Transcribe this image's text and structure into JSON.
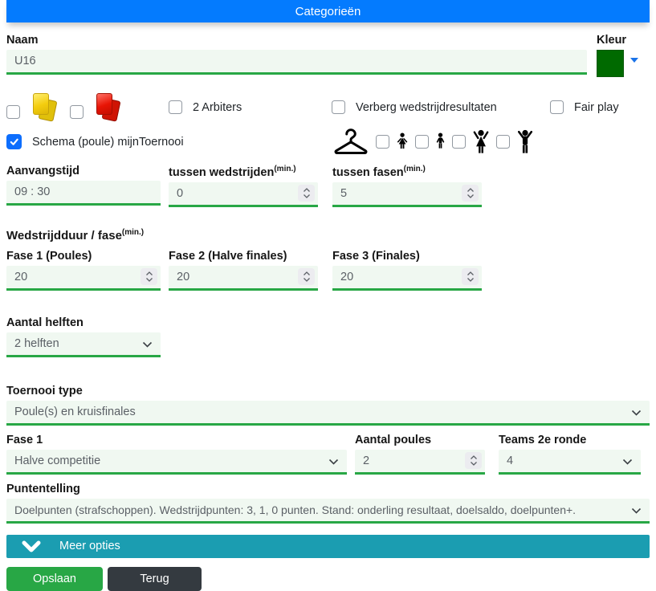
{
  "header": {
    "title": "Categorieën"
  },
  "name_field": {
    "label": "Naam",
    "value": "U16"
  },
  "color_field": {
    "label": "Kleur",
    "value": "#006a00"
  },
  "option_row": {
    "yellow_card": {
      "checked": false,
      "icon": "yellow-cards-icon"
    },
    "red_card": {
      "checked": false,
      "icon": "red-cards-icon"
    },
    "two_arbiters": {
      "label": "2 Arbiters",
      "checked": false
    },
    "hide_results": {
      "label": "Verberg wedstrijdresultaten",
      "checked": false
    },
    "fair_play": {
      "label": "Fair play",
      "checked": false
    }
  },
  "schema_checkbox": {
    "label": "Schema (poule) mijnToernooi",
    "checked": true
  },
  "dress_row": {
    "icons": [
      "hanger-icon",
      "girl-icon",
      "boy-icon",
      "woman-icon",
      "man-icon"
    ],
    "girl": {
      "checked": false
    },
    "boy": {
      "checked": false
    },
    "woman": {
      "checked": false
    },
    "man": {
      "checked": false
    }
  },
  "timing": {
    "start_time": {
      "label": "Aanvangstijd",
      "value": "09 : 30"
    },
    "between_matches": {
      "label": "tussen wedstrijden",
      "unit": "(min.)",
      "value": "0"
    },
    "between_phases": {
      "label": "tussen fasen",
      "unit": "(min.)",
      "value": "5"
    }
  },
  "match_duration": {
    "heading": "Wedstrijdduur / fase",
    "unit": "(min.)",
    "fase1": {
      "label": "Fase 1 (Poules)",
      "value": "20"
    },
    "fase2": {
      "label": "Fase 2 (Halve finales)",
      "value": "20"
    },
    "fase3": {
      "label": "Fase 3 (Finales)",
      "value": "20"
    }
  },
  "halves": {
    "label": "Aantal helften",
    "value": "2 helften"
  },
  "tournament_type": {
    "label": "Toernooi type",
    "value": "Poule(s) en kruisfinales"
  },
  "phase1": {
    "label": "Fase 1",
    "value": "Halve competitie"
  },
  "pool_count": {
    "label": "Aantal poules",
    "value": "2"
  },
  "teams_round2": {
    "label": "Teams 2e ronde",
    "value": "4"
  },
  "scoring": {
    "label": "Puntentelling",
    "value": "Doelpunten (strafschoppen). Wedstrijdpunten: 3, 1, 0 punten. Stand: onderling resultaat, doelsaldo, doelpunten+."
  },
  "more_options": {
    "label": "Meer opties"
  },
  "buttons": {
    "save": "Opslaan",
    "back": "Terug"
  },
  "colors": {
    "header_bg": "#047bfe",
    "accent_green": "#28a745",
    "input_bg": "#f0f8f1",
    "teal_bar": "#1b9db1",
    "save_green": "#28a745",
    "back_dark": "#343a40",
    "checkbox_checked_blue": "#0d6efd",
    "color_swatch": "#006a00",
    "triangle_blue": "#1a73e8"
  }
}
